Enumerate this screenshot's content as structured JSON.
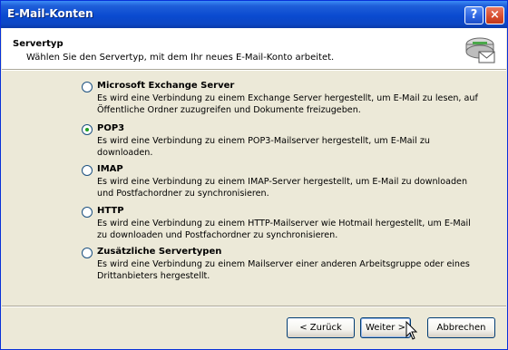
{
  "window": {
    "title": "E-Mail-Konten",
    "help_label": "?",
    "close_label": "×"
  },
  "header": {
    "title": "Servertyp",
    "subtitle": "Wählen Sie den Servertyp, mit dem Ihr neues E-Mail-Konto arbeitet."
  },
  "options": [
    {
      "label": "Microsoft Exchange Server",
      "description": "Es wird eine Verbindung zu einem Exchange Server hergestellt, um E-Mail zu lesen, auf Öffentliche Ordner zuzugreifen und Dokumente freizugeben.",
      "checked": false
    },
    {
      "label": "POP3",
      "description": "Es wird eine Verbindung zu einem POP3-Mailserver hergestellt, um E-Mail zu downloaden.",
      "checked": true
    },
    {
      "label": "IMAP",
      "description": "Es wird eine Verbindung zu einem IMAP-Server hergestellt, um E-Mail zu downloaden und Postfachordner zu synchronisieren.",
      "checked": false
    },
    {
      "label": "HTTP",
      "description": "Es wird eine Verbindung zu einem HTTP-Mailserver wie Hotmail hergestellt, um E-Mail zu downloaden und Postfachordner zu synchronisieren.",
      "checked": false
    },
    {
      "label": "Zusätzliche Servertypen",
      "description": "Es wird eine Verbindung zu einem Mailserver einer anderen Arbeitsgruppe oder eines Drittanbieters hergestellt.",
      "checked": false
    }
  ],
  "buttons": {
    "back": "< Zurück",
    "next": "Weiter >",
    "cancel": "Abbrechen"
  },
  "icons": {
    "header_icon": "server-mail-icon",
    "cursor": "mouse-pointer-icon"
  }
}
